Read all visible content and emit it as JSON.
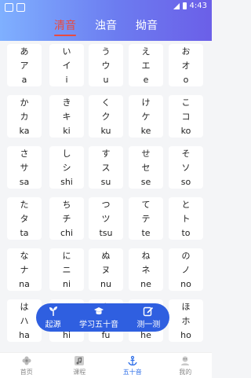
{
  "status_bar": {
    "time": "4:43",
    "icons": [
      "notification-icon",
      "notification-icon",
      "signal-icon",
      "battery-icon"
    ]
  },
  "tabs": [
    {
      "label": "清音",
      "active": true
    },
    {
      "label": "浊音",
      "active": false
    },
    {
      "label": "拗音",
      "active": false
    }
  ],
  "kana": [
    [
      "あ",
      "ア",
      "a"
    ],
    [
      "い",
      "イ",
      "i"
    ],
    [
      "う",
      "ウ",
      "u"
    ],
    [
      "え",
      "エ",
      "e"
    ],
    [
      "お",
      "オ",
      "o"
    ],
    [
      "か",
      "カ",
      "ka"
    ],
    [
      "き",
      "キ",
      "ki"
    ],
    [
      "く",
      "ク",
      "ku"
    ],
    [
      "け",
      "ケ",
      "ke"
    ],
    [
      "こ",
      "コ",
      "ko"
    ],
    [
      "さ",
      "サ",
      "sa"
    ],
    [
      "し",
      "シ",
      "shi"
    ],
    [
      "す",
      "ス",
      "su"
    ],
    [
      "せ",
      "セ",
      "se"
    ],
    [
      "そ",
      "ソ",
      "so"
    ],
    [
      "た",
      "タ",
      "ta"
    ],
    [
      "ち",
      "チ",
      "chi"
    ],
    [
      "つ",
      "ツ",
      "tsu"
    ],
    [
      "て",
      "テ",
      "te"
    ],
    [
      "と",
      "ト",
      "to"
    ],
    [
      "な",
      "ナ",
      "na"
    ],
    [
      "に",
      "ニ",
      "ni"
    ],
    [
      "ぬ",
      "ヌ",
      "nu"
    ],
    [
      "ね",
      "ネ",
      "ne"
    ],
    [
      "の",
      "ノ",
      "no"
    ],
    [
      "は",
      "ハ",
      "ha"
    ],
    [
      "ひ",
      "ヒ",
      "hi"
    ],
    [
      "ふ",
      "フ",
      "fu"
    ],
    [
      "へ",
      "ヘ",
      "he"
    ],
    [
      "ほ",
      "ホ",
      "ho"
    ]
  ],
  "float_bar": [
    {
      "label": "起源",
      "icon": "sprout-icon"
    },
    {
      "label": "学习五十音",
      "icon": "graduation-cap-icon"
    },
    {
      "label": "测一测",
      "icon": "edit-icon"
    }
  ],
  "bottom_nav": [
    {
      "label": "首页",
      "icon": "flower-icon",
      "active": false
    },
    {
      "label": "课程",
      "icon": "music-note-icon",
      "active": false
    },
    {
      "label": "五十音",
      "icon": "anchor-icon",
      "active": true
    },
    {
      "label": "我的",
      "icon": "user-icon",
      "active": false
    }
  ],
  "colors": {
    "header_start": "#7fb0ff",
    "header_end": "#6b5fe8",
    "active_tab": "#e94a3f",
    "float_bar": "#2f5fe0",
    "nav_active": "#2f6fe8"
  }
}
